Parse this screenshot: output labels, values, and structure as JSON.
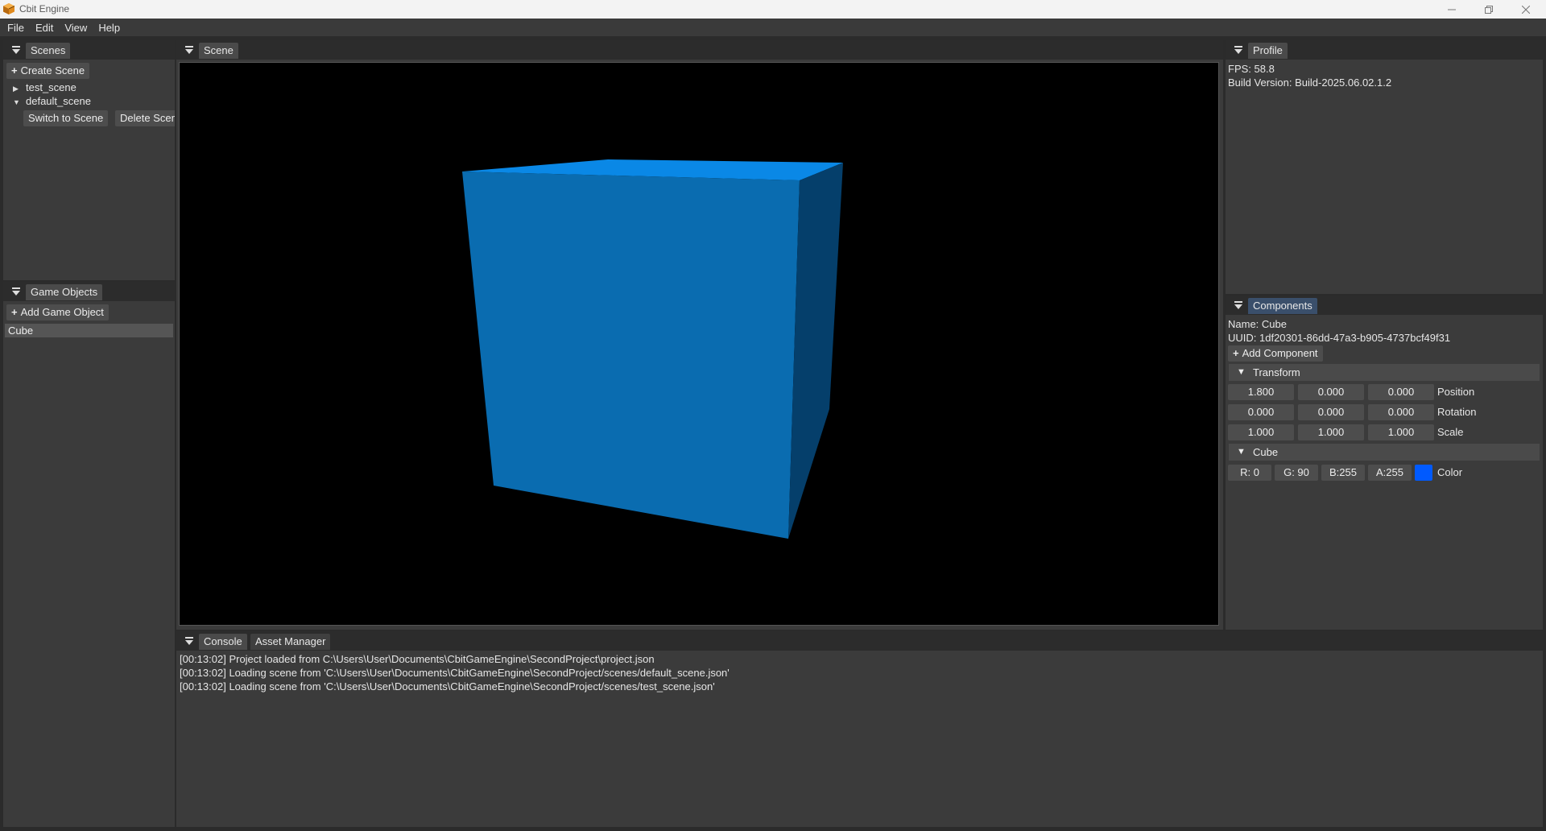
{
  "window": {
    "title": "Cbit Engine",
    "controls": [
      "minimize-icon",
      "restore-icon",
      "close-icon"
    ]
  },
  "menu": {
    "items": [
      "File",
      "Edit",
      "View",
      "Help"
    ]
  },
  "scenes_panel": {
    "tab": "Scenes",
    "create_button": "Create Scene",
    "tree": [
      {
        "label": "test_scene",
        "expanded": false
      },
      {
        "label": "default_scene",
        "expanded": true
      }
    ],
    "switch_button": "Switch to Scene",
    "delete_button": "Delete Scene"
  },
  "game_objects_panel": {
    "tab": "Game Objects",
    "add_button": "Add Game Object",
    "items": [
      {
        "label": "Cube",
        "selected": true
      }
    ]
  },
  "scene_panel": {
    "tab": "Scene",
    "cube_color": "#0078d4"
  },
  "profile_panel": {
    "tab": "Profile",
    "fps": "FPS: 58.8",
    "build": "Build Version: Build-2025.06.02.1.2"
  },
  "components_panel": {
    "tab": "Components",
    "name": "Name: Cube",
    "uuid": "UUID: 1df20301-86dd-47a3-b905-4737bcf49f31",
    "add_button": "Add Component",
    "transform": {
      "header": "Transform",
      "position": {
        "x": "1.800",
        "y": "0.000",
        "z": "0.000",
        "label": "Position"
      },
      "rotation": {
        "x": "0.000",
        "y": "0.000",
        "z": "0.000",
        "label": "Rotation"
      },
      "scale": {
        "x": "1.000",
        "y": "1.000",
        "z": "1.000",
        "label": "Scale"
      }
    },
    "cube": {
      "header": "Cube",
      "r": "R:  0",
      "g": "G: 90",
      "b": "B:255",
      "a": "A:255",
      "swatch_color": "#005aff",
      "label": "Color"
    }
  },
  "console_panel": {
    "tabs": [
      "Console",
      "Asset Manager"
    ],
    "lines": [
      "[00:13:02] Project loaded from C:\\Users\\User\\Documents\\CbitGameEngine\\SecondProject\\project.json",
      "[00:13:02] Loading scene from 'C:\\Users\\User\\Documents\\CbitGameEngine\\SecondProject/scenes/default_scene.json'",
      "[00:13:02] Loading scene from 'C:\\Users\\User\\Documents\\CbitGameEngine\\SecondProject/scenes/test_scene.json'"
    ]
  }
}
